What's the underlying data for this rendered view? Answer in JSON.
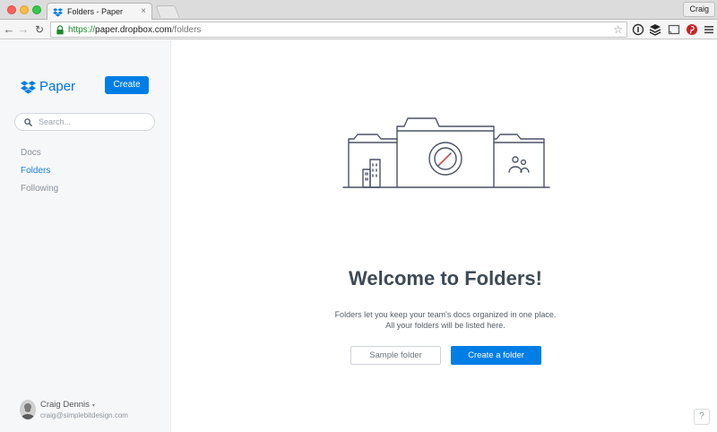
{
  "browser": {
    "tab_title": "Folders - Paper",
    "tab_close": "×",
    "profile_name": "Craig",
    "url_scheme": "https://",
    "url_host": "paper.dropbox.com",
    "url_path": "/folders"
  },
  "sidebar": {
    "logo_text": "Paper",
    "create_label": "Create",
    "search_placeholder": "Search...",
    "nav": {
      "docs": "Docs",
      "folders": "Folders",
      "following": "Following"
    },
    "active_nav": "Folders",
    "user": {
      "name": "Craig Dennis",
      "caret": "▾",
      "email": "craig@simplebitdesign.com"
    }
  },
  "main": {
    "title": "Welcome to Folders!",
    "description_line1": "Folders let you keep your team's docs organized in one place.",
    "description_line2": "All your folders will be listed here.",
    "sample_folder_label": "Sample folder",
    "create_folder_label": "Create a folder",
    "help_label": "?"
  },
  "colors": {
    "accent": "#007ee5",
    "active_nav": "#1a82e2",
    "sidebar_bg": "#f6f7f9",
    "title_text": "#3e4a56"
  },
  "icons": {
    "tab_favicon": "dropbox-icon",
    "lock": "lock-icon",
    "bookmark": "star-icon",
    "extensions": [
      "info-icon",
      "buffer-icon",
      "cast-icon",
      "pinterest-icon",
      "menu-icon"
    ]
  }
}
